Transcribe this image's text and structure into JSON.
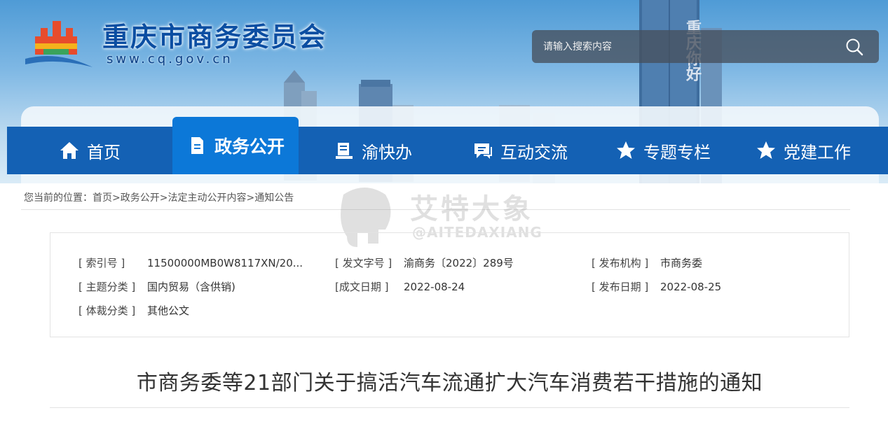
{
  "header": {
    "site_title": "重庆市商务委员会",
    "site_domain": "sww.cq.gov.cn",
    "search_placeholder": "请输入搜索内容",
    "billboard_text": "重庆你好"
  },
  "nav": {
    "items": [
      {
        "label": "首页",
        "icon": "home-icon"
      },
      {
        "label": "政务公开",
        "icon": "document-icon",
        "active": true
      },
      {
        "label": "渝快办",
        "icon": "desk-icon"
      },
      {
        "label": "互动交流",
        "icon": "chat-icon"
      },
      {
        "label": "专题专栏",
        "icon": "star-icon"
      },
      {
        "label": "党建工作",
        "icon": "star-icon"
      }
    ]
  },
  "breadcrumb": {
    "prefix": "您当前的位置：",
    "items": [
      "首页",
      "政务公开",
      "法定主动公开内容",
      "通知公告"
    ],
    "separator": ">"
  },
  "watermark": {
    "cn": "艾特大象",
    "en": "@AITEDAXIANG"
  },
  "info": {
    "index_no": {
      "label": "[ 索引号 ]",
      "value": "11500000MB0W8117XN/20..."
    },
    "doc_no": {
      "label": "[ 发文字号 ]",
      "value": "渝商务〔2022〕289号"
    },
    "publisher": {
      "label": "[ 发布机构 ]",
      "value": "市商务委"
    },
    "topic": {
      "label": "[ 主题分类 ]",
      "value": "国内贸易（含供销)"
    },
    "written_date": {
      "label": "[成文日期 ]",
      "value": "2022-08-24"
    },
    "publish_date": {
      "label": "[ 发布日期 ]",
      "value": "2022-08-25"
    },
    "genre": {
      "label": "[ 体裁分类 ]",
      "value": "其他公文"
    }
  },
  "document": {
    "title": "市商务委等21部门关于搞活汽车流通扩大汽车消费若干措施的通知"
  },
  "colors": {
    "nav_bg": "#1461b4",
    "nav_active": "#0c78d8",
    "brand_blue": "#0b4ea2"
  }
}
